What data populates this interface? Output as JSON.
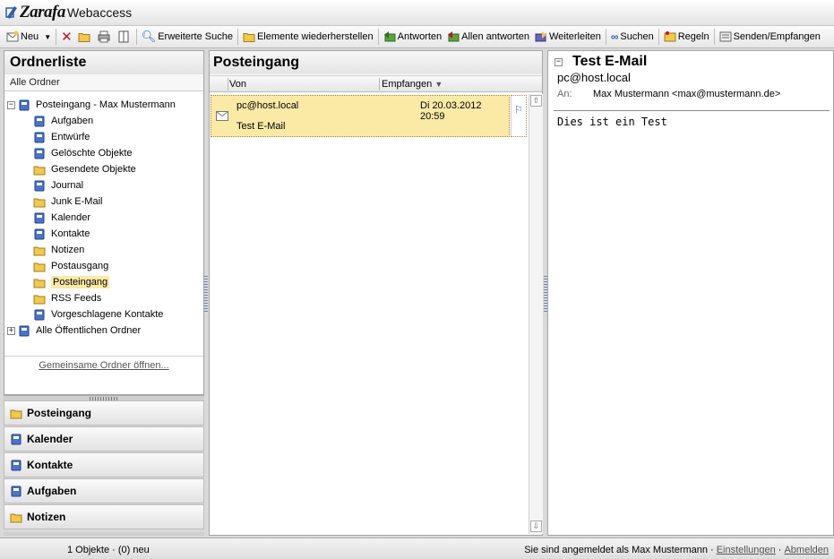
{
  "app": {
    "logo_text": "Zarafa",
    "name": "Webaccess"
  },
  "toolbar": {
    "new_label": "Neu",
    "advanced_search": "Erweiterte Suche",
    "restore": "Elemente wiederherstellen",
    "reply": "Antworten",
    "reply_all": "Allen antworten",
    "forward": "Weiterleiten",
    "search": "Suchen",
    "rules": "Regeln",
    "send_receive": "Senden/Empfangen"
  },
  "left": {
    "title": "Ordnerliste",
    "all_folders": "Alle Ordner",
    "root": "Posteingang - Max Mustermann",
    "folders": [
      "Aufgaben",
      "Entwürfe",
      "Gelöschte Objekte",
      "Gesendete Objekte",
      "Journal",
      "Junk E-Mail",
      "Kalender",
      "Kontakte",
      "Notizen",
      "Postausgang",
      "Posteingang",
      "RSS Feeds",
      "Vorgeschlagene Kontakte"
    ],
    "public_root": "Alle Öffentlichen Ordner",
    "shared_link": "Gemeinsame Ordner öffnen..."
  },
  "nav": [
    "Posteingang",
    "Kalender",
    "Kontakte",
    "Aufgaben",
    "Notizen"
  ],
  "list": {
    "title": "Posteingang",
    "col_from": "Von",
    "col_received": "Empfangen",
    "rows": [
      {
        "from": "pc@host.local",
        "date": "Di 20.03.2012 20:59",
        "subject": "Test E-Mail"
      }
    ]
  },
  "preview": {
    "subject": "Test E-Mail",
    "sender": "pc@host.local",
    "to_label": "An:",
    "to_value": "Max Mustermann <max@mustermann.de>",
    "body": "Dies ist ein Test"
  },
  "status": {
    "count": "1 Objekte · (0) neu",
    "logged_in": "Sie sind angemeldet als Max Mustermann",
    "dot1": "·",
    "settings": "Einstellungen",
    "dot2": "·",
    "logout": "Abmelden"
  },
  "colors": {
    "selection": "#fbe9a6",
    "accent": "#2f5fa8"
  }
}
